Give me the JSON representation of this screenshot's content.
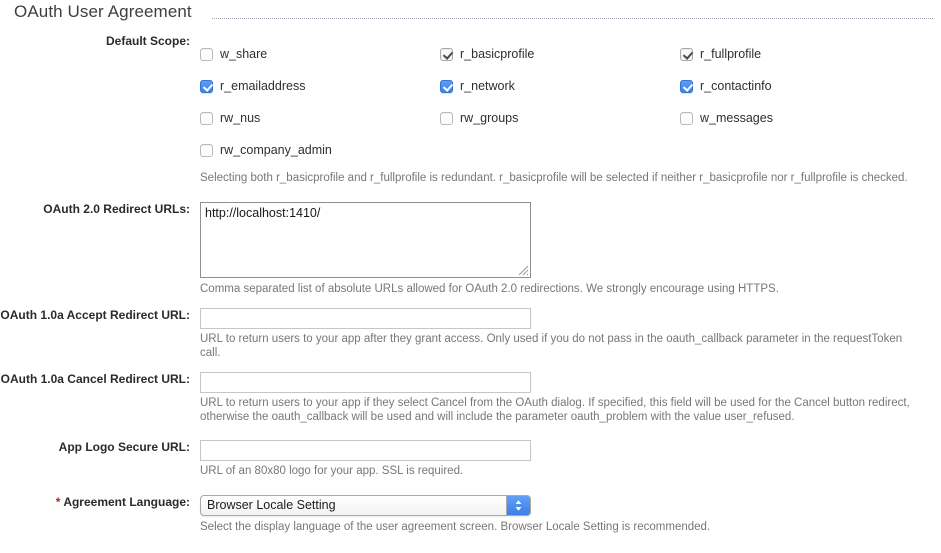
{
  "section": {
    "title": "OAuth User Agreement"
  },
  "fields": {
    "default_scope": {
      "label": "Default Scope:",
      "help": "Selecting both r_basicprofile and r_fullprofile is redundant. r_basicprofile will be selected if neither r_basicprofile nor r_fullprofile is checked.",
      "scopes": [
        {
          "name": "w_share",
          "state": "unchecked"
        },
        {
          "name": "r_basicprofile",
          "state": "checked-disabled"
        },
        {
          "name": "r_fullprofile",
          "state": "checked-disabled"
        },
        {
          "name": "r_emailaddress",
          "state": "checked"
        },
        {
          "name": "r_network",
          "state": "checked"
        },
        {
          "name": "r_contactinfo",
          "state": "checked"
        },
        {
          "name": "rw_nus",
          "state": "unchecked"
        },
        {
          "name": "rw_groups",
          "state": "unchecked"
        },
        {
          "name": "w_messages",
          "state": "unchecked"
        },
        {
          "name": "rw_company_admin",
          "state": "unchecked"
        }
      ]
    },
    "oauth2_redirect_urls": {
      "label": "OAuth 2.0 Redirect URLs:",
      "value": "http://localhost:1410/",
      "help": "Comma separated list of absolute URLs allowed for OAuth 2.0 redirections. We strongly encourage using HTTPS."
    },
    "oauth1_accept_redirect_url": {
      "label": "OAuth 1.0a Accept Redirect URL:",
      "value": "",
      "help": "URL to return users to your app after they grant access. Only used if you do not pass in the oauth_callback parameter in the requestToken call."
    },
    "oauth1_cancel_redirect_url": {
      "label": "OAuth 1.0a Cancel Redirect URL:",
      "value": "",
      "help": "URL to return users to your app if they select Cancel from the OAuth dialog. If specified, this field will be used for the Cancel button redirect, otherwise the oauth_callback will be used and will include the parameter oauth_problem with the value user_refused."
    },
    "app_logo_secure_url": {
      "label": "App Logo Secure URL:",
      "value": "",
      "help": "URL of an 80x80 logo for your app. SSL is required."
    },
    "agreement_language": {
      "required_marker": "*",
      "label": "Agreement Language:",
      "selected": "Browser Locale Setting",
      "help": "Select the display language of the user agreement screen. Browser Locale Setting is recommended."
    }
  },
  "colors": {
    "checkbox_accent": "#4a90f0",
    "required_star": "#b42323",
    "help_text": "#777777",
    "title": "#3f3f3f"
  }
}
